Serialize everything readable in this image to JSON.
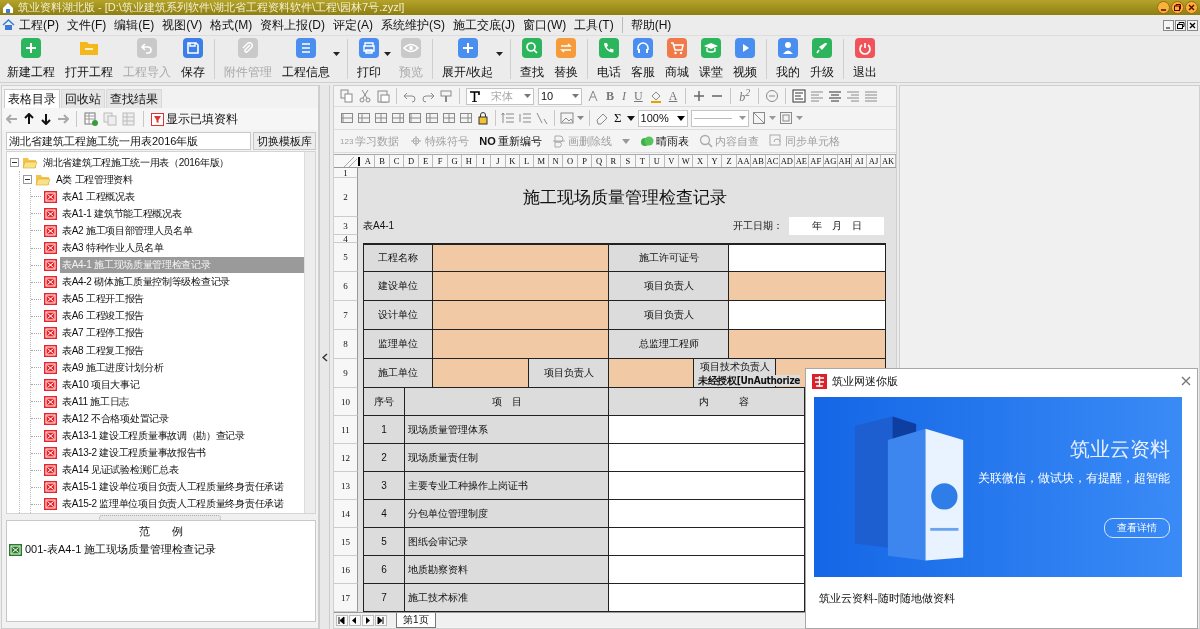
{
  "window": {
    "title": "筑业资料湖北版 - [D:\\筑业建筑系列软件\\湖北省工程资料软件\\工程\\园林7号.zyzl]"
  },
  "menu": [
    "工程(P)",
    "文件(F)",
    "编辑(E)",
    "视图(V)",
    "格式(M)",
    "资料上报(D)",
    "评定(A)",
    "系统维护(S)",
    "施工交底(J)",
    "窗口(W)",
    "工具(T)",
    "帮助(H)"
  ],
  "toolbar": [
    [
      {
        "label": "新建工程",
        "disabled": false,
        "color": "#2db55d"
      },
      {
        "label": "打开工程",
        "disabled": false,
        "color": "#f5b81c"
      },
      {
        "label": "工程导入",
        "disabled": true
      },
      {
        "label": "保存",
        "disabled": false,
        "color": "#3d7fe8"
      }
    ],
    [
      {
        "label": "附件管理",
        "disabled": true
      },
      {
        "label": "工程信息",
        "disabled": false,
        "color": "#4a8ef0",
        "dropdown": true
      }
    ],
    [
      {
        "label": "打印",
        "disabled": false,
        "color": "#4a8ef0",
        "dropdown": true
      },
      {
        "label": "预览",
        "disabled": true
      }
    ],
    [
      {
        "label": "展开/收起",
        "disabled": false,
        "color": "#4a8ef0",
        "dropdown": true
      }
    ],
    [
      {
        "label": "查找",
        "disabled": false,
        "color": "#2db55d"
      },
      {
        "label": "替换",
        "disabled": false,
        "color": "#f79a3a"
      }
    ],
    [
      {
        "label": "电话",
        "disabled": false,
        "color": "#2db55d"
      },
      {
        "label": "客服",
        "disabled": false,
        "color": "#4a8ef0"
      },
      {
        "label": "商城",
        "disabled": false,
        "color": "#f07a4a"
      },
      {
        "label": "课堂",
        "disabled": false,
        "color": "#2db55d"
      },
      {
        "label": "视频",
        "disabled": false,
        "color": "#4a8ef0"
      }
    ],
    [
      {
        "label": "我的",
        "disabled": false,
        "color": "#4a8ef0"
      },
      {
        "label": "升级",
        "disabled": false,
        "color": "#2db55d"
      }
    ],
    [
      {
        "label": "退出",
        "disabled": false,
        "color": "#f0545a"
      }
    ]
  ],
  "left_panel": {
    "tabs": [
      {
        "label": "表格目录",
        "selected": true
      },
      {
        "label": "回收站",
        "selected": false
      },
      {
        "label": "查找结果",
        "selected": false
      }
    ],
    "filter_button": "显示已填资料",
    "template_field": "湖北省建筑工程施工统一用表2016年版",
    "switch_button": "切换模板库",
    "tree": [
      {
        "label": "湖北省建筑工程施工统一用表（2016年版）",
        "kind": "folder",
        "expanded": true,
        "children": [
          {
            "label": "A类 工程管理资料",
            "kind": "folder",
            "expanded": true,
            "children": [
              {
                "label": "表A1 工程概况表",
                "kind": "form",
                "selected": false
              },
              {
                "label": "表A1-1 建筑节能工程概况表",
                "kind": "form",
                "selected": false
              },
              {
                "label": "表A2 施工项目部管理人员名单",
                "kind": "form",
                "selected": false
              },
              {
                "label": "表A3 特种作业人员名单",
                "kind": "form",
                "selected": false
              },
              {
                "label": "表A4-1 施工现场质量管理检查记录",
                "kind": "form",
                "selected": true
              },
              {
                "label": "表A4-2 砌体施工质量控制等级检查记录",
                "kind": "form",
                "selected": false
              },
              {
                "label": "表A5 工程开工报告",
                "kind": "form",
                "selected": false
              },
              {
                "label": "表A6 工程竣工报告",
                "kind": "form",
                "selected": false
              },
              {
                "label": "表A7 工程停工报告",
                "kind": "form",
                "selected": false
              },
              {
                "label": "表A8 工程复工报告",
                "kind": "form",
                "selected": false
              },
              {
                "label": "表A9 施工进度计划分析",
                "kind": "form",
                "selected": false
              },
              {
                "label": "表A10 项目大事记",
                "kind": "form",
                "selected": false
              },
              {
                "label": "表A11 施工日志",
                "kind": "form",
                "selected": false
              },
              {
                "label": "表A12 不合格项处置记录",
                "kind": "form",
                "selected": false
              },
              {
                "label": "表A13-1 建设工程质量事故调（勘）查记录",
                "kind": "form",
                "selected": false
              },
              {
                "label": "表A13-2 建设工程质量事故报告书",
                "kind": "form",
                "selected": false
              },
              {
                "label": "表A14 见证试验检测汇总表",
                "kind": "form",
                "selected": false
              },
              {
                "label": "表A15-1 建设单位项目负责人工程质量终身责任承诺",
                "kind": "form",
                "selected": false
              },
              {
                "label": "表A15-2 监理单位项目负责人工程质量终身责任承诺",
                "kind": "form",
                "selected": false
              }
            ]
          }
        ]
      }
    ],
    "example_panel": {
      "title": "范　　例",
      "items": [
        {
          "label": "001-表A4-1 施工现场质量管理检查记录"
        }
      ]
    }
  },
  "format_bar": {
    "font": {
      "value": "宋体",
      "disabled": true
    },
    "size": {
      "value": "10",
      "disabled": false
    },
    "style_buttons": [
      "B",
      "I",
      "U"
    ],
    "font_color": "A",
    "superscript": "b$^{2}$",
    "sum": "Σ",
    "zoom": "100%"
  },
  "tools": [
    {
      "icon_text": "123",
      "label": "学习数据",
      "disabled": true
    },
    {
      "label": "特殊符号",
      "disabled": true
    },
    {
      "icon_text": "NO",
      "label": "重新编号",
      "disabled": false
    },
    {
      "label": "画删除线",
      "disabled": true,
      "dropdown": true
    },
    {
      "label": "晴雨表",
      "disabled": false
    },
    {
      "label": "内容自查",
      "disabled": true
    },
    {
      "label": "同步单元格",
      "disabled": true
    }
  ],
  "sheet": {
    "columns": [
      "A",
      "B",
      "C",
      "D",
      "E",
      "F",
      "G",
      "H",
      "I",
      "J",
      "K",
      "L",
      "M",
      "N",
      "O",
      "P",
      "Q",
      "R",
      "S",
      "T",
      "U",
      "V",
      "W",
      "X",
      "Y",
      "Z",
      "AA",
      "AB",
      "AC",
      "AD",
      "AE",
      "AF",
      "AG",
      "AH",
      "AI",
      "AJ",
      "AK"
    ],
    "rows": [
      {
        "number": "1",
        "kind": "spacer"
      },
      {
        "number": "2",
        "kind": "title",
        "cells": [
          {
            "text": "施工现场质量管理检查记录"
          }
        ]
      },
      {
        "number": "3",
        "kind": "meta",
        "cells": [
          {
            "text": "表A4-1"
          },
          {
            "text": "开工日期："
          },
          {
            "text": "年　月　日"
          }
        ]
      },
      {
        "number": "4",
        "kind": "spacer"
      },
      {
        "number": "5",
        "kind": "info",
        "cells": [
          {
            "kind": "label",
            "text": "工程名称"
          },
          {
            "kind": "input",
            "required": true
          },
          {
            "kind": "label",
            "text": "施工许可证号"
          },
          {
            "kind": "input",
            "required": false
          }
        ]
      },
      {
        "number": "6",
        "kind": "info",
        "cells": [
          {
            "kind": "label",
            "text": "建设单位"
          },
          {
            "kind": "input",
            "required": true
          },
          {
            "kind": "label",
            "text": "项目负责人"
          },
          {
            "kind": "input",
            "required": true
          }
        ]
      },
      {
        "number": "7",
        "kind": "info",
        "cells": [
          {
            "kind": "label",
            "text": "设计单位"
          },
          {
            "kind": "input",
            "required": true
          },
          {
            "kind": "label",
            "text": "项目负责人"
          },
          {
            "kind": "input",
            "required": false
          }
        ]
      },
      {
        "number": "8",
        "kind": "info",
        "cells": [
          {
            "kind": "label",
            "text": "监理单位"
          },
          {
            "kind": "input",
            "required": true
          },
          {
            "kind": "label",
            "text": "总监理工程师"
          },
          {
            "kind": "input",
            "required": true
          }
        ]
      },
      {
        "number": "9",
        "kind": "info_split",
        "cells": [
          {
            "kind": "label",
            "text": "施工单位"
          },
          {
            "kind": "input",
            "required": true
          },
          {
            "kind": "label",
            "text": "项目负责人"
          },
          {
            "kind": "input",
            "required": true
          },
          {
            "kind": "label",
            "text": "项目技术负责人"
          },
          {
            "kind": "input",
            "required": true
          }
        ]
      },
      {
        "number": "10",
        "kind": "header",
        "cells": [
          {
            "kind": "label",
            "text": "序号"
          },
          {
            "kind": "label",
            "text": "项　目"
          },
          {
            "kind": "label",
            "text": "内　　　容"
          }
        ]
      },
      {
        "number": "11",
        "kind": "item",
        "cells": [
          {
            "kind": "label",
            "text": "1"
          },
          {
            "kind": "label",
            "text": "现场质量管理体系"
          },
          {
            "kind": "input",
            "required": false
          }
        ]
      },
      {
        "number": "12",
        "kind": "item",
        "cells": [
          {
            "kind": "label",
            "text": "2"
          },
          {
            "kind": "label",
            "text": "现场质量责任制"
          },
          {
            "kind": "input",
            "required": false
          }
        ]
      },
      {
        "number": "13",
        "kind": "item",
        "cells": [
          {
            "kind": "label",
            "text": "3"
          },
          {
            "kind": "label",
            "text": "主要专业工种操作上岗证书"
          },
          {
            "kind": "input",
            "required": false
          }
        ]
      },
      {
        "number": "14",
        "kind": "item",
        "cells": [
          {
            "kind": "label",
            "text": "4"
          },
          {
            "kind": "label",
            "text": "分包单位管理制度"
          },
          {
            "kind": "input",
            "required": false
          }
        ]
      },
      {
        "number": "15",
        "kind": "item",
        "cells": [
          {
            "kind": "label",
            "text": "5"
          },
          {
            "kind": "label",
            "text": "图纸会审记录"
          },
          {
            "kind": "input",
            "required": false
          }
        ]
      },
      {
        "number": "16",
        "kind": "item",
        "cells": [
          {
            "kind": "label",
            "text": "6"
          },
          {
            "kind": "label",
            "text": "地质勘察资料"
          },
          {
            "kind": "input",
            "required": false
          }
        ]
      },
      {
        "number": "17",
        "kind": "item",
        "cells": [
          {
            "kind": "label",
            "text": "7"
          },
          {
            "kind": "label",
            "text": "施工技术标准"
          },
          {
            "kind": "input",
            "required": false
          }
        ]
      }
    ],
    "unauthorized_notice": "未经授权[UnAuthorize",
    "tabs": [
      {
        "label": "第1页",
        "selected": true
      }
    ]
  },
  "popup": {
    "title": "筑业网迷你版",
    "banner_title": "筑业云资料",
    "banner_slogan": "关联微信，做试块，有提醒，超智能",
    "banner_button": "查看详情",
    "caption": "筑业云资料-随时随地做资料"
  }
}
